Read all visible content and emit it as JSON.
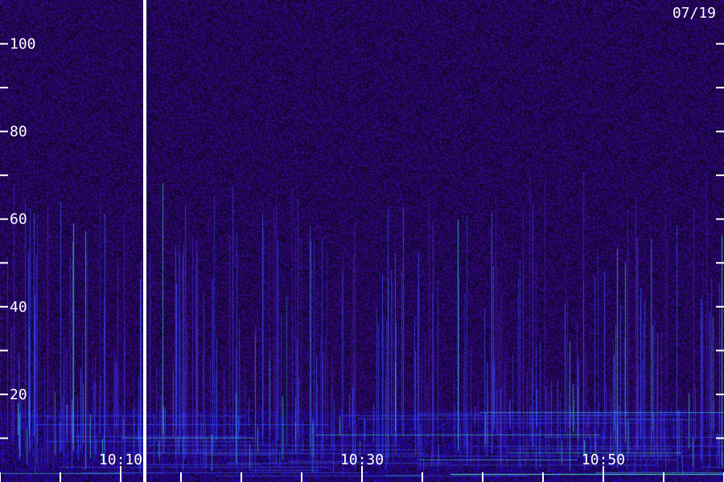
{
  "chart_data": {
    "type": "heatmap",
    "title": "",
    "date_label": "07/19",
    "xlabel": "",
    "ylabel": "",
    "x_ticks": [
      "10:10",
      "10:30",
      "10:50"
    ],
    "y_ticks": [
      100,
      80,
      60,
      40,
      20
    ],
    "y_minor_ticks": [
      90,
      70,
      50,
      30,
      10
    ],
    "ylim": [
      0,
      110
    ],
    "grid": false,
    "colormap": [
      "#1a0838",
      "#3a10a0",
      "#1c3cff",
      "#2aa0ff",
      "#00ffb0",
      "#ffffff"
    ],
    "background_color": "#1a0838",
    "marker_color": "#ffffff"
  }
}
